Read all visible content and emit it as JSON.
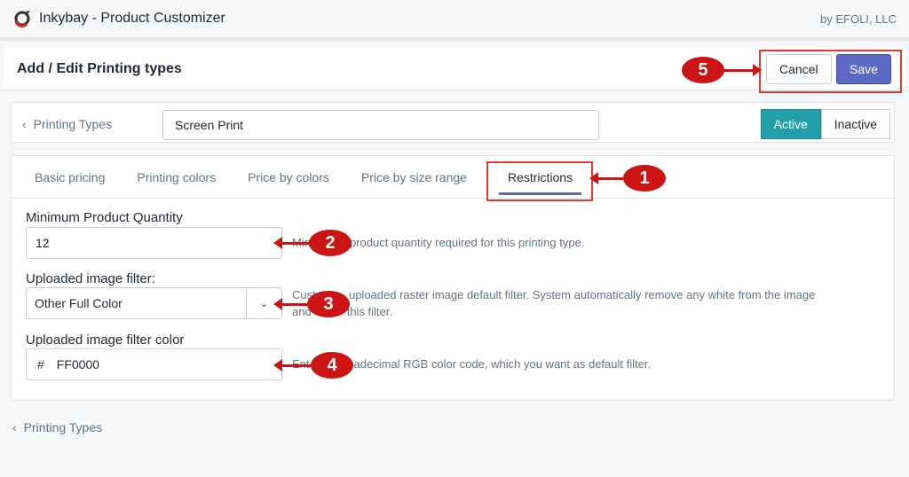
{
  "app": {
    "title": "Inkybay - Product Customizer",
    "vendor": "by EFOLI, LLC"
  },
  "header": {
    "title": "Add / Edit Printing types",
    "cancel": "Cancel",
    "save": "Save"
  },
  "top": {
    "back": "Printing Types",
    "name_value": "Screen Print",
    "active": "Active",
    "inactive": "Inactive"
  },
  "tabs": [
    {
      "label": "Basic pricing"
    },
    {
      "label": "Printing colors"
    },
    {
      "label": "Price by colors"
    },
    {
      "label": "Price by size range"
    },
    {
      "label": "Restrictions",
      "selected": true
    }
  ],
  "fields": {
    "min_qty": {
      "label": "Minimum Product Quantity",
      "value": "12",
      "help_a": "Min",
      "help_b": "product quantity required for this printing type."
    },
    "filter": {
      "label": "Uploaded image filter:",
      "value": "Other Full Color",
      "help_a": "Custo",
      "help_b": "uploaded raster image default filter. System automatically remove any white from the image",
      "help_c": "and",
      "help_d": "this filter."
    },
    "color": {
      "label": "Uploaded image filter color",
      "prefix": "#",
      "value": "FF0000",
      "help_a": "Ent",
      "help_b": "adecimal RGB color code, which you want as default filter."
    }
  },
  "footer": {
    "back": "Printing Types"
  },
  "markers": [
    "1",
    "2",
    "3",
    "4",
    "5"
  ],
  "colors": {
    "primary": "#5c6ac4",
    "active": "#21a0aa",
    "annotation": "#cc1414"
  }
}
